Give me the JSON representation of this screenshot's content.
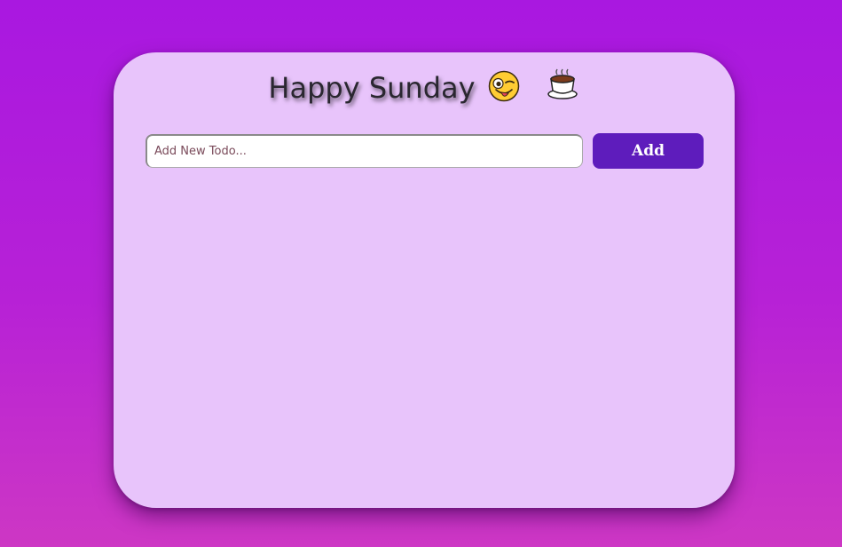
{
  "header": {
    "title": "Happy Sunday",
    "emojis": [
      "winking-tongue-face-icon",
      "hot-beverage-icon"
    ]
  },
  "todo": {
    "placeholder": "Add New Todo...",
    "value": "",
    "add_label": "Add",
    "items": []
  },
  "colors": {
    "background_top": "#a918e0",
    "background_bottom": "#cd37c4",
    "card": "#e8c4fb",
    "button": "#5e1cbc"
  }
}
